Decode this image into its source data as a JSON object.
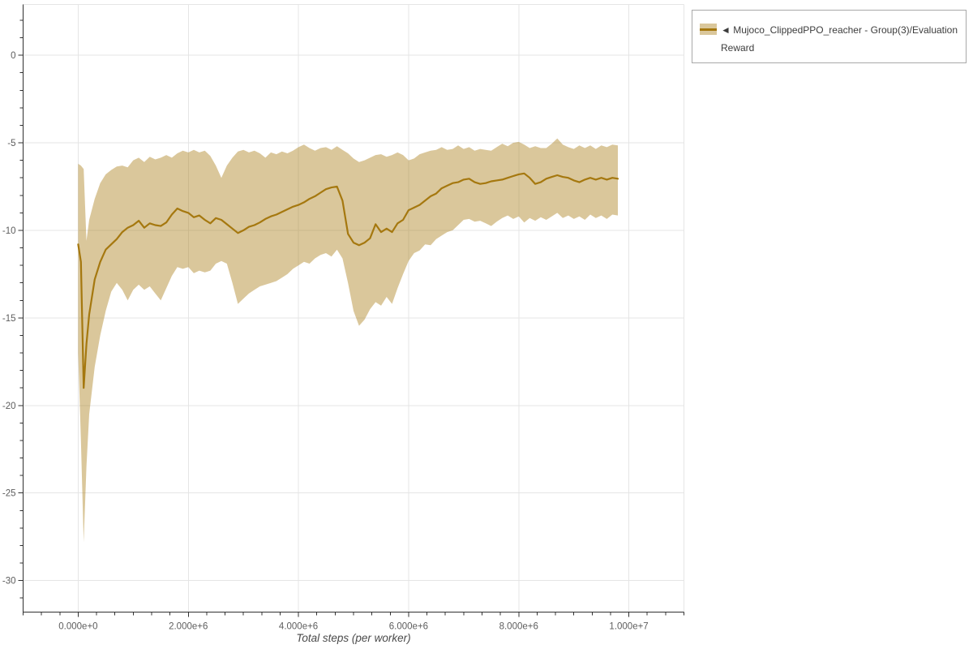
{
  "page": {
    "background": "#ffffff"
  },
  "chart_data": {
    "type": "line",
    "title": "",
    "xlabel": "Total steps (per worker)",
    "ylabel": "",
    "grid": true,
    "legend_position": "outside-top-right",
    "x_range_steps": [
      -1000000,
      11000000
    ],
    "y_range": [
      -31.8,
      2.9
    ],
    "x_axis": {
      "title": "Total steps (per worker)",
      "tick_values_steps": [
        0,
        2000000,
        4000000,
        6000000,
        8000000,
        10000000
      ],
      "tick_labels": [
        "0.000e+0",
        "2.000e+6",
        "4.000e+6",
        "6.000e+6",
        "8.000e+6",
        "1.000e+7"
      ],
      "minor_tick_interval_steps": 333333.33
    },
    "y_axis": {
      "tick_values": [
        0,
        -5,
        -10,
        -15,
        -20,
        -25,
        -30
      ],
      "tick_labels": [
        "0",
        "-5",
        "-10",
        "-15",
        "-20",
        "-25",
        "-30"
      ],
      "minor_tick_interval": 1
    },
    "legend": {
      "label": "◄ Mujoco_ClippedPPO_reacher - Group(3)/Evaluation Reward",
      "label_lines": [
        "◄ Mujoco_ClippedPPO_reacher - Group(3)/Evaluation",
        "Reward"
      ]
    },
    "series": [
      {
        "name": "Mujoco_ClippedPPO_reacher - Group(3)/Evaluation Reward",
        "x_steps_millions": [
          0,
          0.05,
          0.1,
          0.15,
          0.2,
          0.3,
          0.4,
          0.5,
          0.6,
          0.7,
          0.8,
          0.9,
          1,
          1.1,
          1.2,
          1.3,
          1.4,
          1.5,
          1.6,
          1.7,
          1.8,
          1.9,
          2,
          2.1,
          2.2,
          2.3,
          2.4,
          2.5,
          2.6,
          2.7,
          2.8,
          2.9,
          3,
          3.1,
          3.2,
          3.3,
          3.4,
          3.5,
          3.6,
          3.7,
          3.8,
          3.9,
          4,
          4.1,
          4.2,
          4.3,
          4.4,
          4.5,
          4.6,
          4.7,
          4.8,
          4.9,
          5,
          5.1,
          5.2,
          5.3,
          5.4,
          5.5,
          5.6,
          5.7,
          5.8,
          5.9,
          6,
          6.1,
          6.2,
          6.3,
          6.4,
          6.5,
          6.6,
          6.7,
          6.8,
          6.9,
          7,
          7.1,
          7.2,
          7.3,
          7.4,
          7.5,
          7.6,
          7.7,
          7.8,
          7.9,
          8,
          8.1,
          8.2,
          8.3,
          8.4,
          8.5,
          8.6,
          8.7,
          8.8,
          8.9,
          9,
          9.1,
          9.2,
          9.3,
          9.4,
          9.5,
          9.6,
          9.7,
          9.8
        ],
        "mean": [
          -10.8,
          -11.8,
          -19,
          -16.5,
          -14.8,
          -12.8,
          -11.8,
          -11.1,
          -10.8,
          -10.5,
          -10.1,
          -9.85,
          -9.7,
          -9.45,
          -9.85,
          -9.6,
          -9.7,
          -9.75,
          -9.55,
          -9.1,
          -8.75,
          -8.9,
          -9,
          -9.25,
          -9.15,
          -9.4,
          -9.6,
          -9.3,
          -9.4,
          -9.65,
          -9.9,
          -10.15,
          -10,
          -9.8,
          -9.7,
          -9.55,
          -9.35,
          -9.2,
          -9.1,
          -8.95,
          -8.8,
          -8.65,
          -8.55,
          -8.4,
          -8.2,
          -8.05,
          -7.85,
          -7.65,
          -7.55,
          -7.5,
          -8.3,
          -10.2,
          -10.7,
          -10.85,
          -10.7,
          -10.45,
          -9.65,
          -10.1,
          -9.9,
          -10.1,
          -9.6,
          -9.4,
          -8.85,
          -8.7,
          -8.55,
          -8.3,
          -8.05,
          -7.9,
          -7.6,
          -7.45,
          -7.3,
          -7.25,
          -7.1,
          -7.05,
          -7.25,
          -7.35,
          -7.3,
          -7.2,
          -7.15,
          -7.1,
          -7,
          -6.9,
          -6.8,
          -6.75,
          -7,
          -7.35,
          -7.25,
          -7.05,
          -6.95,
          -6.85,
          -6.95,
          -7,
          -7.15,
          -7.25,
          -7.1,
          -7,
          -7.1,
          -7,
          -7.1,
          -7,
          -7.05
        ],
        "band_upper": [
          -6.2,
          -6.3,
          -6.5,
          -10.6,
          -9.4,
          -8.2,
          -7.3,
          -6.8,
          -6.55,
          -6.35,
          -6.3,
          -6.4,
          -6,
          -5.85,
          -6.1,
          -5.8,
          -5.95,
          -5.85,
          -5.7,
          -5.85,
          -5.6,
          -5.45,
          -5.55,
          -5.4,
          -5.55,
          -5.45,
          -5.75,
          -6.3,
          -7,
          -6.3,
          -5.85,
          -5.5,
          -5.4,
          -5.55,
          -5.45,
          -5.6,
          -5.85,
          -5.55,
          -5.65,
          -5.5,
          -5.6,
          -5.45,
          -5.25,
          -5.1,
          -5.3,
          -5.45,
          -5.3,
          -5.25,
          -5.4,
          -5.2,
          -5.4,
          -5.6,
          -5.9,
          -6.1,
          -6,
          -5.85,
          -5.7,
          -5.65,
          -5.8,
          -5.7,
          -5.55,
          -5.7,
          -6,
          -5.9,
          -5.65,
          -5.55,
          -5.45,
          -5.4,
          -5.25,
          -5.4,
          -5.35,
          -5.15,
          -5.35,
          -5.25,
          -5.45,
          -5.35,
          -5.4,
          -5.45,
          -5.25,
          -5.05,
          -5.2,
          -5,
          -4.95,
          -5.1,
          -5.3,
          -5.2,
          -5.3,
          -5.3,
          -5.05,
          -4.75,
          -5.1,
          -5.25,
          -5.35,
          -5.15,
          -5.3,
          -5.15,
          -5.35,
          -5.15,
          -5.25,
          -5.1,
          -5.15
        ],
        "band_lower": [
          -17,
          -22,
          -27.8,
          -23.5,
          -20.5,
          -17.8,
          -16,
          -14.6,
          -13.5,
          -13,
          -13.4,
          -14,
          -13.4,
          -13.1,
          -13.4,
          -13.2,
          -13.6,
          -14,
          -13.3,
          -12.6,
          -12.1,
          -12.2,
          -12.1,
          -12.45,
          -12.3,
          -12.4,
          -12.3,
          -11.9,
          -11.75,
          -11.9,
          -13,
          -14.2,
          -13.9,
          -13.6,
          -13.4,
          -13.2,
          -13.1,
          -13,
          -12.9,
          -12.7,
          -12.5,
          -12.2,
          -12,
          -11.8,
          -11.9,
          -11.6,
          -11.4,
          -11.3,
          -11.5,
          -11.1,
          -11.6,
          -13,
          -14.6,
          -15.45,
          -15.1,
          -14.5,
          -14.1,
          -14.3,
          -13.8,
          -14.2,
          -13.3,
          -12.5,
          -11.75,
          -11.3,
          -11.15,
          -10.8,
          -10.85,
          -10.5,
          -10.3,
          -10.1,
          -10,
          -9.7,
          -9.4,
          -9.35,
          -9.5,
          -9.45,
          -9.6,
          -9.75,
          -9.5,
          -9.3,
          -9.15,
          -9.35,
          -9.2,
          -9.55,
          -9.3,
          -9.45,
          -9.25,
          -9.4,
          -9.2,
          -9,
          -9.3,
          -9.15,
          -9.35,
          -9.2,
          -9.4,
          -9.1,
          -9.3,
          -9.15,
          -9.35,
          -9.1,
          -9.15
        ]
      }
    ],
    "colors": {
      "line": "#a5780f",
      "band_fill": "rgba(168,122,16,0.42)",
      "grid": "#e5e5e5",
      "axis": "#303030",
      "tick_label": "#5d5d5d",
      "axis_title": "#4a4a4a",
      "legend_border": "#a9a9a9",
      "legend_text": "#3c3c3c",
      "background": "#ffffff"
    }
  }
}
